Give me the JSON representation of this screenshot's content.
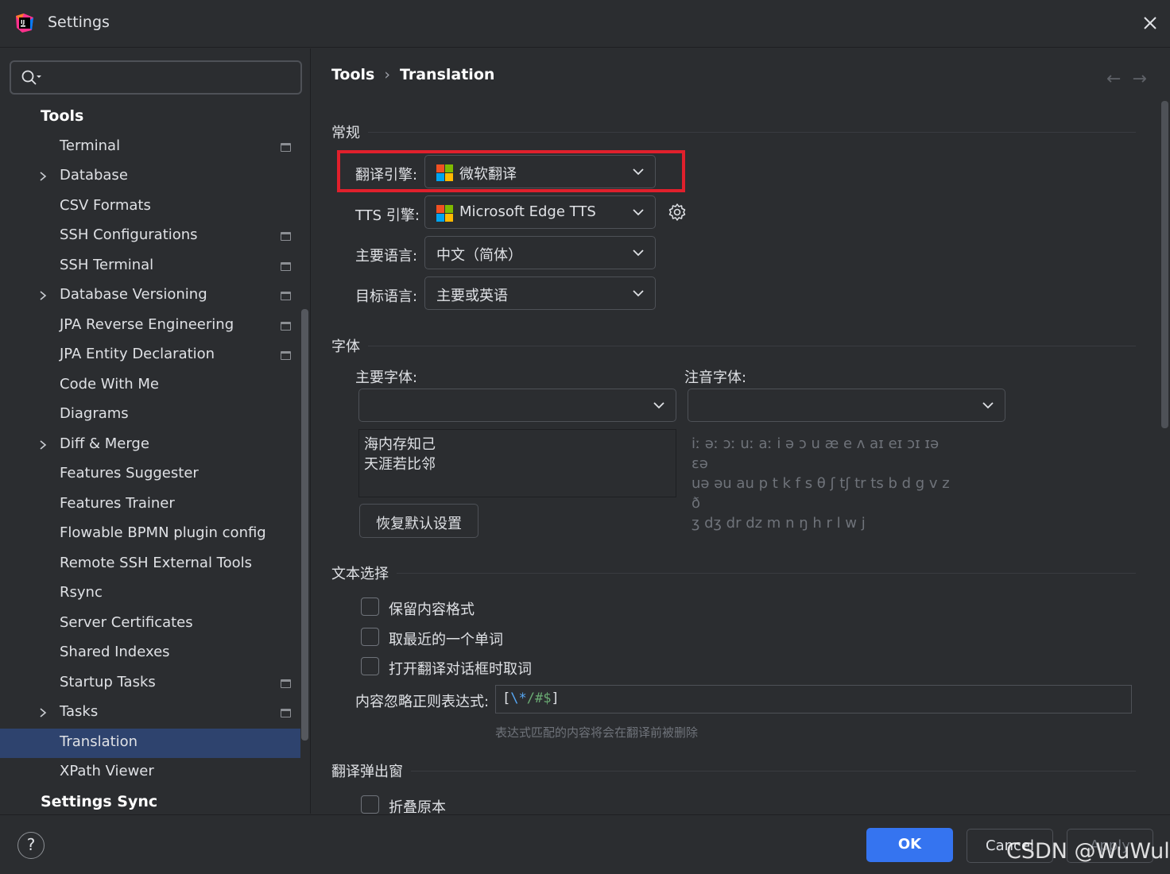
{
  "window": {
    "title": "Settings"
  },
  "sidebar": {
    "search_placeholder": "",
    "items": [
      {
        "label": "Tools",
        "kind": "group"
      },
      {
        "label": "Terminal",
        "kind": "child",
        "badge": true
      },
      {
        "label": "Database",
        "kind": "child",
        "expandable": true
      },
      {
        "label": "CSV Formats",
        "kind": "child"
      },
      {
        "label": "SSH Configurations",
        "kind": "child",
        "badge": true
      },
      {
        "label": "SSH Terminal",
        "kind": "child",
        "badge": true
      },
      {
        "label": "Database Versioning",
        "kind": "child",
        "expandable": true,
        "badge": true
      },
      {
        "label": "JPA Reverse Engineering",
        "kind": "child",
        "badge": true
      },
      {
        "label": "JPA Entity Declaration",
        "kind": "child",
        "badge": true
      },
      {
        "label": "Code With Me",
        "kind": "child"
      },
      {
        "label": "Diagrams",
        "kind": "child"
      },
      {
        "label": "Diff & Merge",
        "kind": "child",
        "expandable": true
      },
      {
        "label": "Features Suggester",
        "kind": "child"
      },
      {
        "label": "Features Trainer",
        "kind": "child"
      },
      {
        "label": "Flowable BPMN plugin config",
        "kind": "child"
      },
      {
        "label": "Remote SSH External Tools",
        "kind": "child"
      },
      {
        "label": "Rsync",
        "kind": "child"
      },
      {
        "label": "Server Certificates",
        "kind": "child"
      },
      {
        "label": "Shared Indexes",
        "kind": "child"
      },
      {
        "label": "Startup Tasks",
        "kind": "child",
        "badge": true
      },
      {
        "label": "Tasks",
        "kind": "child",
        "expandable": true,
        "badge": true
      },
      {
        "label": "Translation",
        "kind": "child",
        "selected": true
      },
      {
        "label": "XPath Viewer",
        "kind": "child"
      },
      {
        "label": "Settings Sync",
        "kind": "group"
      }
    ]
  },
  "breadcrumb": {
    "parent": "Tools",
    "separator": "›",
    "current": "Translation"
  },
  "nav": {
    "back": "←",
    "forward": "→"
  },
  "general": {
    "section_title": "常规",
    "translator_label": "翻译引擎:",
    "translator_value": "微软翻译",
    "tts_label": "TTS 引擎:",
    "tts_value": "Microsoft Edge TTS",
    "primary_lang_label": "主要语言:",
    "primary_lang_value": "中文（简体）",
    "target_lang_label": "目标语言:",
    "target_lang_value": "主要或英语"
  },
  "fonts": {
    "section_title": "字体",
    "primary_font_label": "主要字体:",
    "primary_font_value": "",
    "phonetic_font_label": "注音字体:",
    "phonetic_font_value": "",
    "preview_line1": "海内存知己",
    "preview_line2": "天涯若比邻",
    "phonetic_line1": "iː əː ɔː uː aː i ə ɔ u æ e ʌ aɪ eɪ ɔɪ ɪə ɛə",
    "phonetic_line2": "uə əu au p t k f s θ ʃ tʃ tr ts b d g v z ð",
    "phonetic_line3": "ʒ dʒ dr dz m n ŋ h r l w j",
    "restore_button": "恢复默认设置"
  },
  "text_selection": {
    "section_title": "文本选择",
    "keep_format": "保留内容格式",
    "nearest_word": "取最近的一个单词",
    "take_on_open": "打开翻译对话框时取词",
    "ignore_regex_label": "内容忽略正则表达式:",
    "ignore_regex_value": "[\\*/#$]",
    "ignore_regex_hint": "表达式匹配的内容将会在翻译前被删除"
  },
  "popup": {
    "section_title": "翻译弹出窗",
    "fold_original": "折叠原本"
  },
  "footer": {
    "help": "?",
    "ok": "OK",
    "cancel": "Cancel",
    "apply": "Apply",
    "watermark": "CSDN @WuWull"
  },
  "colors": {
    "accent": "#3574f0",
    "selection": "#2e436e",
    "highlight_box": "#e0202c",
    "background": "#2b2d30"
  }
}
